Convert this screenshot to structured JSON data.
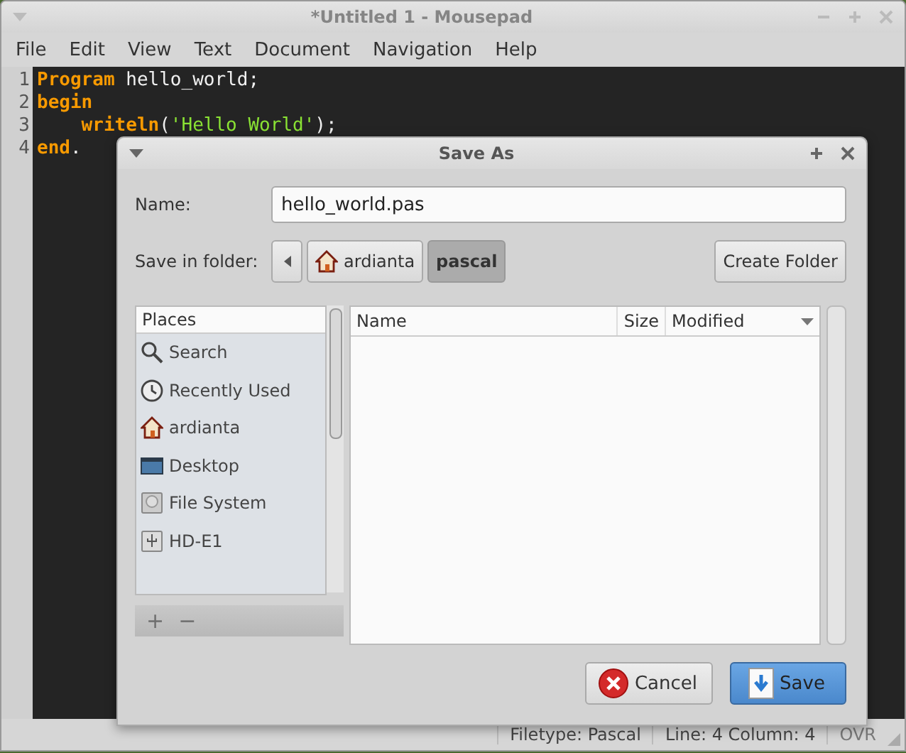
{
  "window": {
    "title": "*Untitled 1 - Mousepad"
  },
  "menu": [
    "File",
    "Edit",
    "View",
    "Text",
    "Document",
    "Navigation",
    "Help"
  ],
  "editor": {
    "lines": [
      {
        "number": "1",
        "tokens": [
          {
            "kind": "keyword",
            "text": "Program"
          },
          {
            "kind": "plain",
            "text": " hello_world;"
          }
        ]
      },
      {
        "number": "2",
        "tokens": [
          {
            "kind": "keyword",
            "text": "begin"
          }
        ]
      },
      {
        "number": "3",
        "tokens": [
          {
            "kind": "keyword",
            "text": "    writeln"
          },
          {
            "kind": "plain",
            "text": "("
          },
          {
            "kind": "string",
            "text": "'Hello World'"
          },
          {
            "kind": "plain",
            "text": ");"
          }
        ]
      },
      {
        "number": "4",
        "tokens": [
          {
            "kind": "keyword",
            "text": "end"
          },
          {
            "kind": "plain",
            "text": "."
          }
        ]
      }
    ]
  },
  "dialog": {
    "title": "Save As",
    "name_label": "Name:",
    "name_value": "hello_world.pas",
    "folder_label": "Save in folder:",
    "path": [
      {
        "label": "ardianta",
        "selected": false
      },
      {
        "label": "pascal",
        "selected": true
      }
    ],
    "create_folder": "Create Folder",
    "places": {
      "heading": "Places",
      "items": [
        {
          "label": "Search"
        },
        {
          "label": "Recently Used"
        },
        {
          "label": "ardianta"
        },
        {
          "label": "Desktop"
        },
        {
          "label": "File System"
        },
        {
          "label": "HD-E1"
        }
      ],
      "add": {
        "label": "+",
        "disabled": true
      },
      "remove": {
        "label": "−",
        "disabled": true
      }
    },
    "columns": [
      "Name",
      "Size",
      "Modified"
    ],
    "buttons": [
      {
        "label": "Cancel",
        "kind": "cancel"
      },
      {
        "label": "Save",
        "kind": "save"
      }
    ]
  },
  "status_bar": [
    {
      "text": "Filetype: Pascal",
      "disabled": false
    },
    {
      "text": "Line: 4 Column: 4",
      "disabled": false
    },
    {
      "text": "OVR",
      "disabled": true
    }
  ]
}
